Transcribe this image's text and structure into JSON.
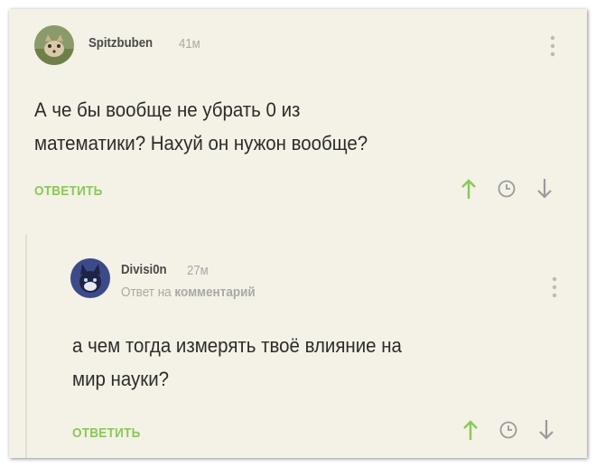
{
  "colors": {
    "background": "#f4f1e6",
    "accent_green": "#8ac858",
    "username": "#4a4a4a",
    "meta": "#a9a9a9",
    "text": "#2c2c2c"
  },
  "comments": [
    {
      "username": "Spitzbuben",
      "time": "41м",
      "text_line1": "А че бы вообще не убрать 0 из",
      "text_line2": "математики? Нахуй он нужон вообще?",
      "reply_label": "ОТВЕТИТЬ",
      "icons": [
        "upvote-arrow-icon",
        "clock-icon",
        "downvote-arrow-icon",
        "more-vertical-icon"
      ]
    },
    {
      "username": "Divisi0n",
      "time": "27м",
      "reply_prefix": "Ответ на",
      "reply_target": "комментарий",
      "text_line1": "а чем тогда измерять твоё влияние на",
      "text_line2": "мир науки?",
      "reply_label": "ОТВЕТИТЬ",
      "icons": [
        "upvote-arrow-icon",
        "clock-icon",
        "downvote-arrow-icon",
        "more-vertical-icon"
      ]
    }
  ]
}
